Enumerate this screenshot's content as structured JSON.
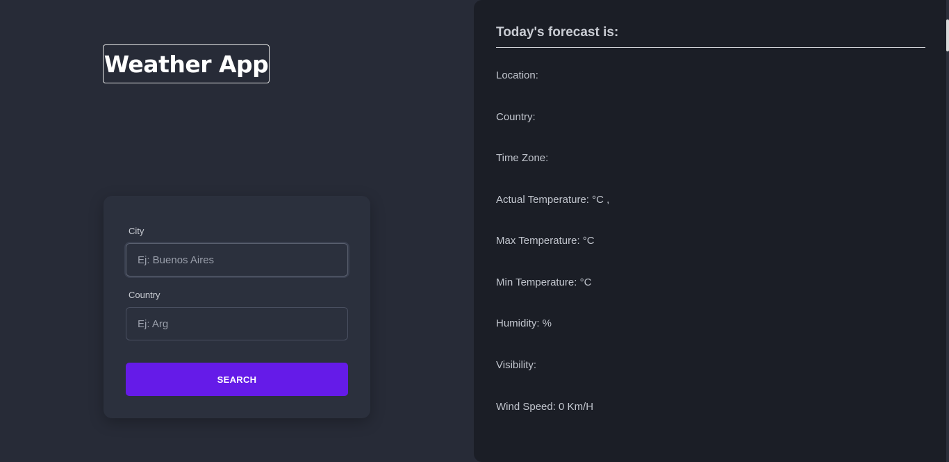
{
  "header": {
    "title": "Weather App"
  },
  "form": {
    "city_label": "City",
    "city_placeholder": "Ej: Buenos Aires",
    "country_label": "Country",
    "country_placeholder": "Ej: Arg",
    "search_label": "SEARCH"
  },
  "forecast": {
    "title": "Today's forecast is:",
    "lines": [
      "Location:",
      "Country:",
      "Time Zone:",
      "Actual Temperature: °C ,",
      "Max Temperature: °C",
      "Min Temperature: °C",
      "Humidity: %",
      "Visibility:",
      "Wind Speed: 0 Km/H"
    ]
  },
  "colors": {
    "background": "#272b37",
    "panel": "#1b1e26",
    "card": "#2b303d",
    "accent": "#651be8"
  }
}
